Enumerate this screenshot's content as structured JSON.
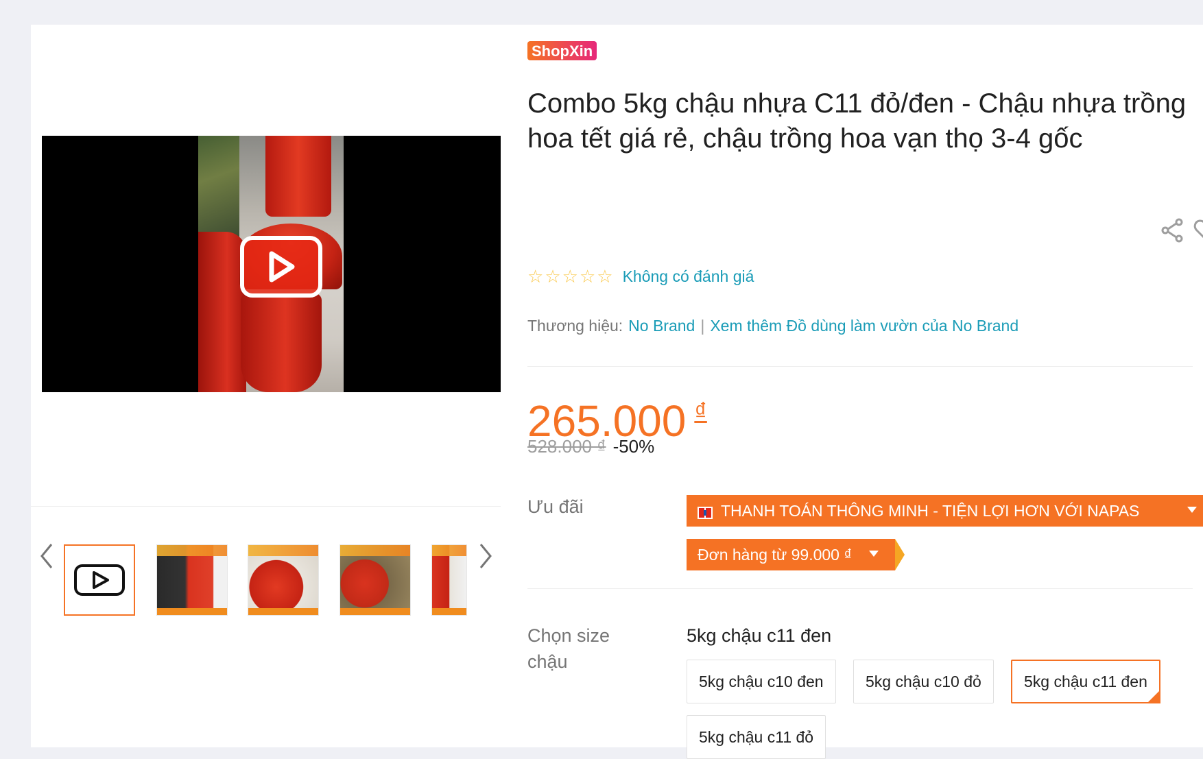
{
  "shop_badge": "ShopXin",
  "product": {
    "title": "Combo 5kg chậu nhựa C11 đỏ/đen - Chậu nhựa trồng hoa tết giá rẻ, chậu trồng hoa vạn thọ 3-4 gốc",
    "rating_text": "Không có đánh giá",
    "brand_label": "Thương hiệu:",
    "brand_name": "No Brand",
    "brand_more": "Xem thêm Đồ dùng làm vườn của No Brand",
    "price": "265.000",
    "currency": "₫",
    "old_price": "528.000 ₫",
    "discount": "-50%"
  },
  "promotions": {
    "label": "Ưu đãi",
    "items": [
      "THANH TOÁN THÔNG MINH - TIỆN LỢI HƠN VỚI NAPAS",
      "Đơn hàng từ 99.000 ₫"
    ]
  },
  "size": {
    "label": "Chọn size chậu",
    "selected": "5kg chậu c11 đen",
    "options": [
      "5kg chậu c10 đen",
      "5kg chậu c10 đỏ",
      "5kg chậu c11 đen",
      "5kg chậu c11 đỏ"
    ]
  },
  "colors": {
    "accent": "#f57224",
    "link": "#1a9cb7",
    "star": "#faca51"
  },
  "icons": {
    "play": "play-icon",
    "share": "share-icon",
    "heart": "heart-icon",
    "prev": "chevron-left-icon",
    "next": "chevron-right-icon"
  }
}
